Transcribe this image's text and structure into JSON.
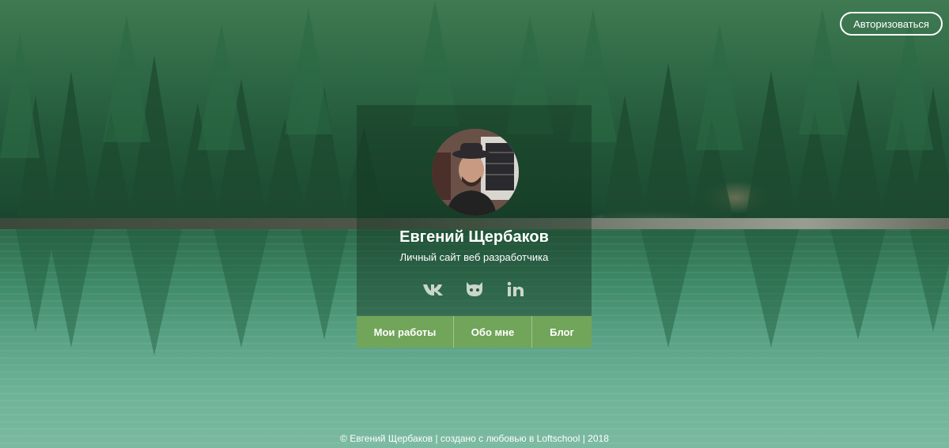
{
  "header": {
    "auth_button_label": "Авторизоваться"
  },
  "profile": {
    "name": "Евгений Щербаков",
    "subtitle": "Личный сайт веб разработчика"
  },
  "socials": [
    {
      "icon": "vk-icon"
    },
    {
      "icon": "github-icon"
    },
    {
      "icon": "linkedin-icon"
    }
  ],
  "nav": {
    "works_label": "Мои работы",
    "about_label": "Обо мне",
    "blog_label": "Блог"
  },
  "footer": {
    "text": "© Евгений Щербаков | создано с любовью в Loftschool | 2018"
  },
  "colors": {
    "accent": "#71a55a",
    "card_overlay": "rgba(20,50,30,0.42)",
    "text": "#ffffff"
  }
}
